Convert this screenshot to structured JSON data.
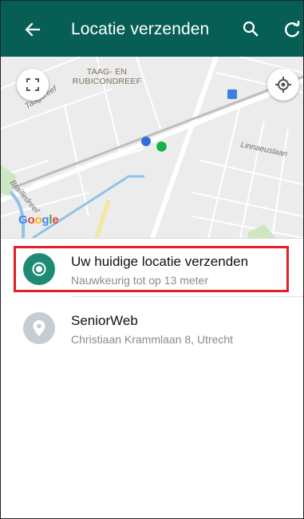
{
  "appbar": {
    "title": "Locatie verzenden",
    "back_icon": "arrow-left-icon",
    "search_icon": "search-icon",
    "refresh_icon": "refresh-icon",
    "color": "#075e54"
  },
  "map": {
    "area_label_line1": "TAAG- EN",
    "area_label_line2": "RUBICONDREEF",
    "street_labels": [
      "Taagdreef",
      "Linnaeuslaan",
      "Brailledreef"
    ],
    "google_logo": "Google",
    "fullscreen_icon": "fullscreen-icon",
    "my_location_icon": "my-location-icon"
  },
  "locations": [
    {
      "title": "Uw huidige locatie verzenden",
      "subtitle": "Nauwkeurig tot op 13 meter",
      "icon": "current-location-icon",
      "icon_color": "#1f8a74"
    },
    {
      "title": "SeniorWeb",
      "subtitle": "Christiaan Krammlaan 8, Utrecht",
      "icon": "place-pin-icon",
      "icon_color": "#c5ccd2"
    }
  ]
}
